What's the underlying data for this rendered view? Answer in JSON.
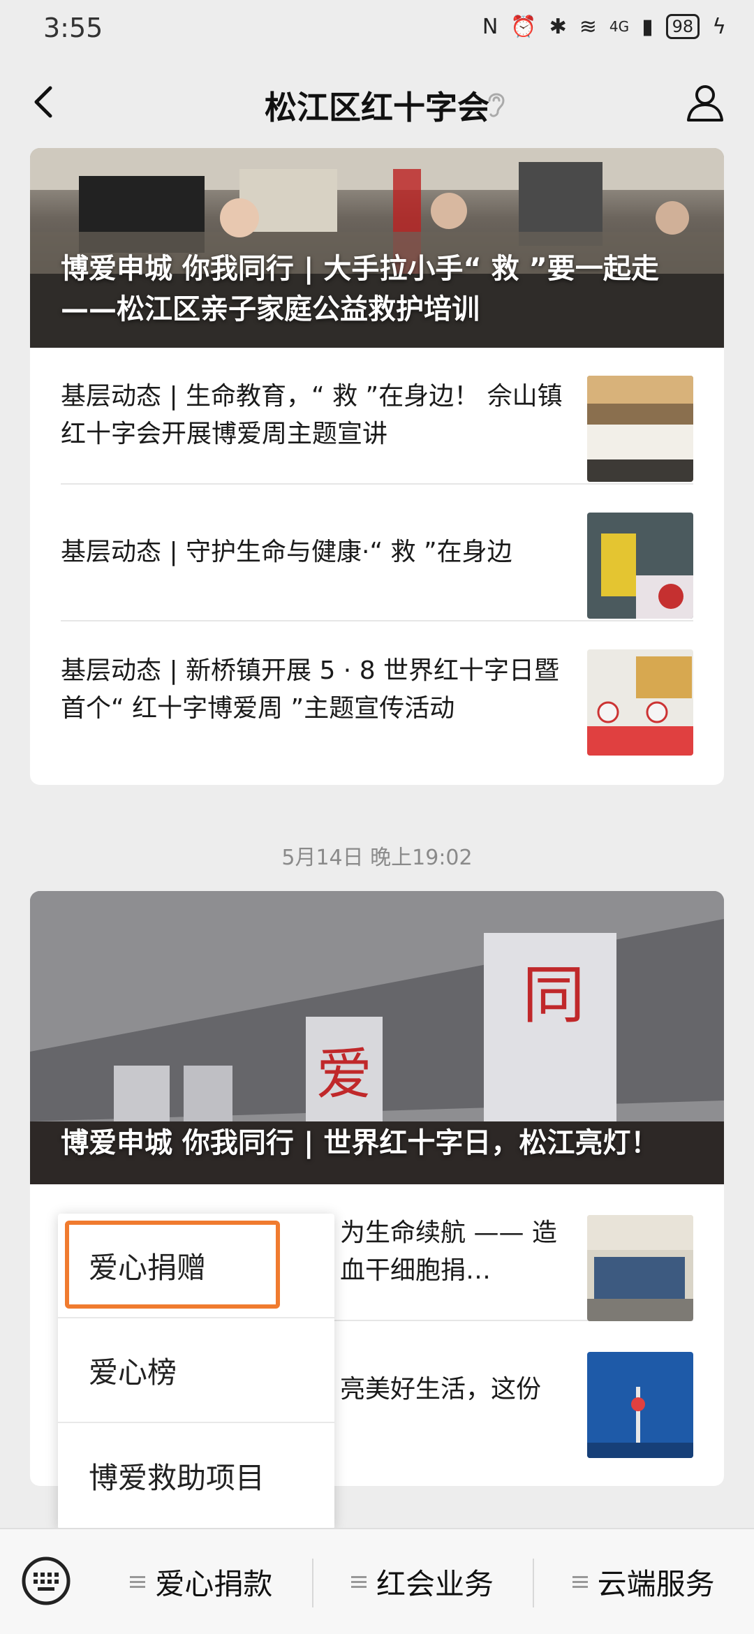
{
  "status_bar": {
    "time": "3:55",
    "battery": "98",
    "network": "4G"
  },
  "header": {
    "title": "松江区红十字会",
    "back_icon": "chevron-left-icon",
    "profile_icon": "user-icon",
    "ear_icon": "ear-icon"
  },
  "feed": [
    {
      "hero_title": "博爱申城 你我同行 | 大手拉小手“ 救 ”要一起走——松江区亲子家庭公益救护培训",
      "items": [
        {
          "title": "基层动态 | 生命教育，“ 救 ”在身边！ 佘山镇红十字会开展博爱周主题宣讲"
        },
        {
          "title": "基层动态 | 守护生命与健康·“ 救 ”在身边"
        },
        {
          "title": "基层动态 | 新桥镇开展 5 · 8 世界红十字日暨首个“ 红十字博爱周 ”主题宣传活动"
        }
      ]
    },
    {
      "date": "5月14日 晚上19:02",
      "hero_title": "博爱申城 你我同行 | 世界红十字日，松江亮灯！",
      "items": [
        {
          "title": "为生命续航 —— 造血干细胞捐…"
        },
        {
          "title": "亮美好生活，这份"
        }
      ]
    }
  ],
  "popup_menu": {
    "options": [
      "爱心捐赠",
      "爱心榜",
      "博爱救助项目"
    ],
    "highlighted": "爱心捐赠"
  },
  "bottom_bar": {
    "keyboard_icon": "keyboard-icon",
    "menus": [
      "爱心捐款",
      "红会业务",
      "云端服务"
    ]
  },
  "colors": {
    "highlight": "#f07b2f",
    "background": "#ededed"
  }
}
